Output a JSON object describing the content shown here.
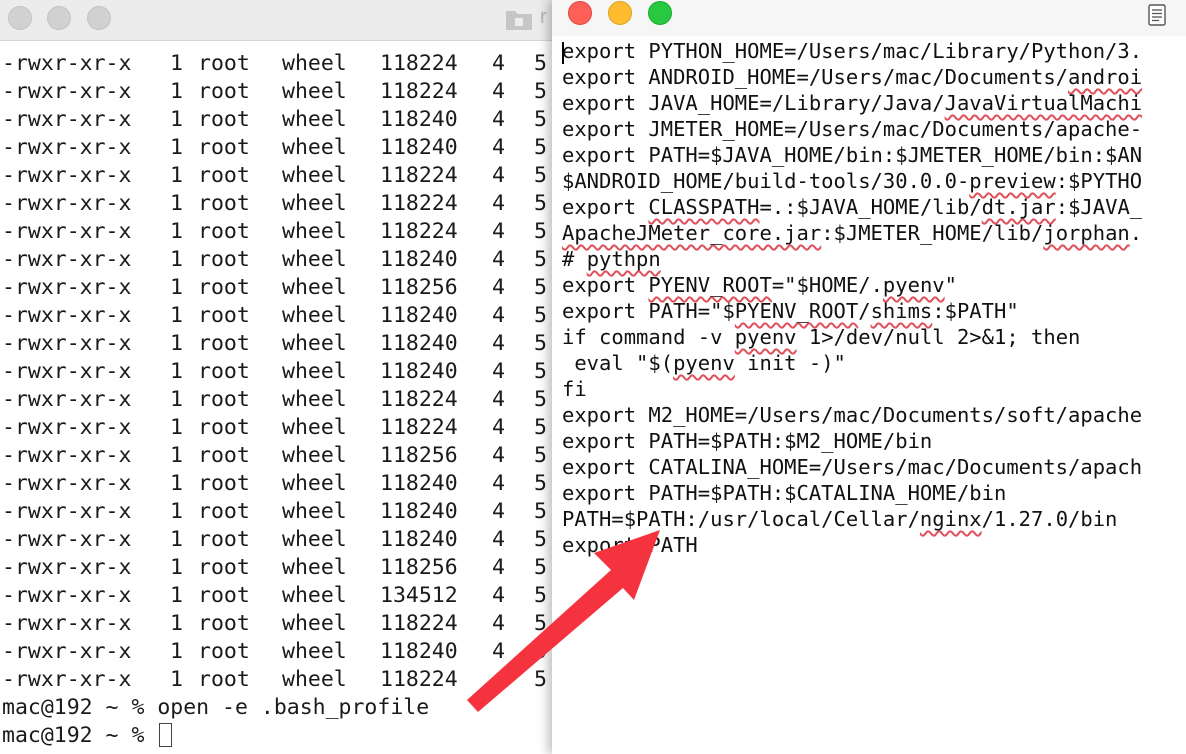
{
  "terminal": {
    "title_fragment": "r",
    "listing": [
      {
        "perm": "-rwxr-xr-x",
        "links": "1",
        "owner": "root",
        "group": "wheel",
        "size": "118224",
        "n": "4",
        "m": "5"
      },
      {
        "perm": "-rwxr-xr-x",
        "links": "1",
        "owner": "root",
        "group": "wheel",
        "size": "118224",
        "n": "4",
        "m": "5"
      },
      {
        "perm": "-rwxr-xr-x",
        "links": "1",
        "owner": "root",
        "group": "wheel",
        "size": "118240",
        "n": "4",
        "m": "5"
      },
      {
        "perm": "-rwxr-xr-x",
        "links": "1",
        "owner": "root",
        "group": "wheel",
        "size": "118240",
        "n": "4",
        "m": "5"
      },
      {
        "perm": "-rwxr-xr-x",
        "links": "1",
        "owner": "root",
        "group": "wheel",
        "size": "118224",
        "n": "4",
        "m": "5"
      },
      {
        "perm": "-rwxr-xr-x",
        "links": "1",
        "owner": "root",
        "group": "wheel",
        "size": "118224",
        "n": "4",
        "m": "5"
      },
      {
        "perm": "-rwxr-xr-x",
        "links": "1",
        "owner": "root",
        "group": "wheel",
        "size": "118224",
        "n": "4",
        "m": "5"
      },
      {
        "perm": "-rwxr-xr-x",
        "links": "1",
        "owner": "root",
        "group": "wheel",
        "size": "118240",
        "n": "4",
        "m": "5"
      },
      {
        "perm": "-rwxr-xr-x",
        "links": "1",
        "owner": "root",
        "group": "wheel",
        "size": "118256",
        "n": "4",
        "m": "5"
      },
      {
        "perm": "-rwxr-xr-x",
        "links": "1",
        "owner": "root",
        "group": "wheel",
        "size": "118240",
        "n": "4",
        "m": "5"
      },
      {
        "perm": "-rwxr-xr-x",
        "links": "1",
        "owner": "root",
        "group": "wheel",
        "size": "118240",
        "n": "4",
        "m": "5"
      },
      {
        "perm": "-rwxr-xr-x",
        "links": "1",
        "owner": "root",
        "group": "wheel",
        "size": "118240",
        "n": "4",
        "m": "5"
      },
      {
        "perm": "-rwxr-xr-x",
        "links": "1",
        "owner": "root",
        "group": "wheel",
        "size": "118224",
        "n": "4",
        "m": "5"
      },
      {
        "perm": "-rwxr-xr-x",
        "links": "1",
        "owner": "root",
        "group": "wheel",
        "size": "118224",
        "n": "4",
        "m": "5"
      },
      {
        "perm": "-rwxr-xr-x",
        "links": "1",
        "owner": "root",
        "group": "wheel",
        "size": "118256",
        "n": "4",
        "m": "5"
      },
      {
        "perm": "-rwxr-xr-x",
        "links": "1",
        "owner": "root",
        "group": "wheel",
        "size": "118240",
        "n": "4",
        "m": "5"
      },
      {
        "perm": "-rwxr-xr-x",
        "links": "1",
        "owner": "root",
        "group": "wheel",
        "size": "118240",
        "n": "4",
        "m": "5"
      },
      {
        "perm": "-rwxr-xr-x",
        "links": "1",
        "owner": "root",
        "group": "wheel",
        "size": "118240",
        "n": "4",
        "m": "5"
      },
      {
        "perm": "-rwxr-xr-x",
        "links": "1",
        "owner": "root",
        "group": "wheel",
        "size": "118256",
        "n": "4",
        "m": "5"
      },
      {
        "perm": "-rwxr-xr-x",
        "links": "1",
        "owner": "root",
        "group": "wheel",
        "size": "134512",
        "n": "4",
        "m": "5"
      },
      {
        "perm": "-rwxr-xr-x",
        "links": "1",
        "owner": "root",
        "group": "wheel",
        "size": "118224",
        "n": "4",
        "m": "5"
      },
      {
        "perm": "-rwxr-xr-x",
        "links": "1",
        "owner": "root",
        "group": "wheel",
        "size": "118240",
        "n": "4",
        "m": "5"
      },
      {
        "perm": "-rwxr-xr-x",
        "links": "1",
        "owner": "root",
        "group": "wheel",
        "size": "118224",
        "n": "",
        "m": "5"
      }
    ],
    "prompt_1": "mac@192 ~ % open -e .bash_profile",
    "prompt_2": "mac@192 ~ % "
  },
  "editor": {
    "lines": [
      "export PYTHON_HOME=/Users/mac/Library/Python/3.",
      "export ANDROID_HOME=/Users/mac/Documents/androi",
      "export JAVA_HOME=/Library/Java/JavaVirtualMachi",
      "export JMETER_HOME=/Users/mac/Documents/apache-",
      "export PATH=$JAVA_HOME/bin:$JMETER_HOME/bin:$AN",
      "$ANDROID_HOME/build-tools/30.0.0-preview:$PYTHO",
      "export CLASSPATH=.:$JAVA_HOME/lib/dt.jar:$JAVA_",
      "ApacheJMeter_core.jar:$JMETER_HOME/lib/jorphan.",
      "# pythpn",
      "export PYENV_ROOT=\"$HOME/.pyenv\"",
      "export PATH=\"$PYENV_ROOT/shims:$PATH\"",
      "if command -v pyenv 1>/dev/null 2>&1; then",
      " eval \"$(pyenv init -)\"",
      "fi",
      "export M2_HOME=/Users/mac/Documents/soft/apache",
      "export PATH=$PATH:$M2_HOME/bin",
      "export CATALINA_HOME=/Users/mac/Documents/apach",
      "export PATH=$PATH:$CATALINA_HOME/bin",
      "PATH=$PATH:/usr/local/Cellar/nginx/1.27.0/bin",
      "export PATH"
    ]
  },
  "colors": {
    "arrow": "#f5333f",
    "close": "#fe5f57",
    "minimize": "#febc2e",
    "maximize": "#28c840"
  }
}
